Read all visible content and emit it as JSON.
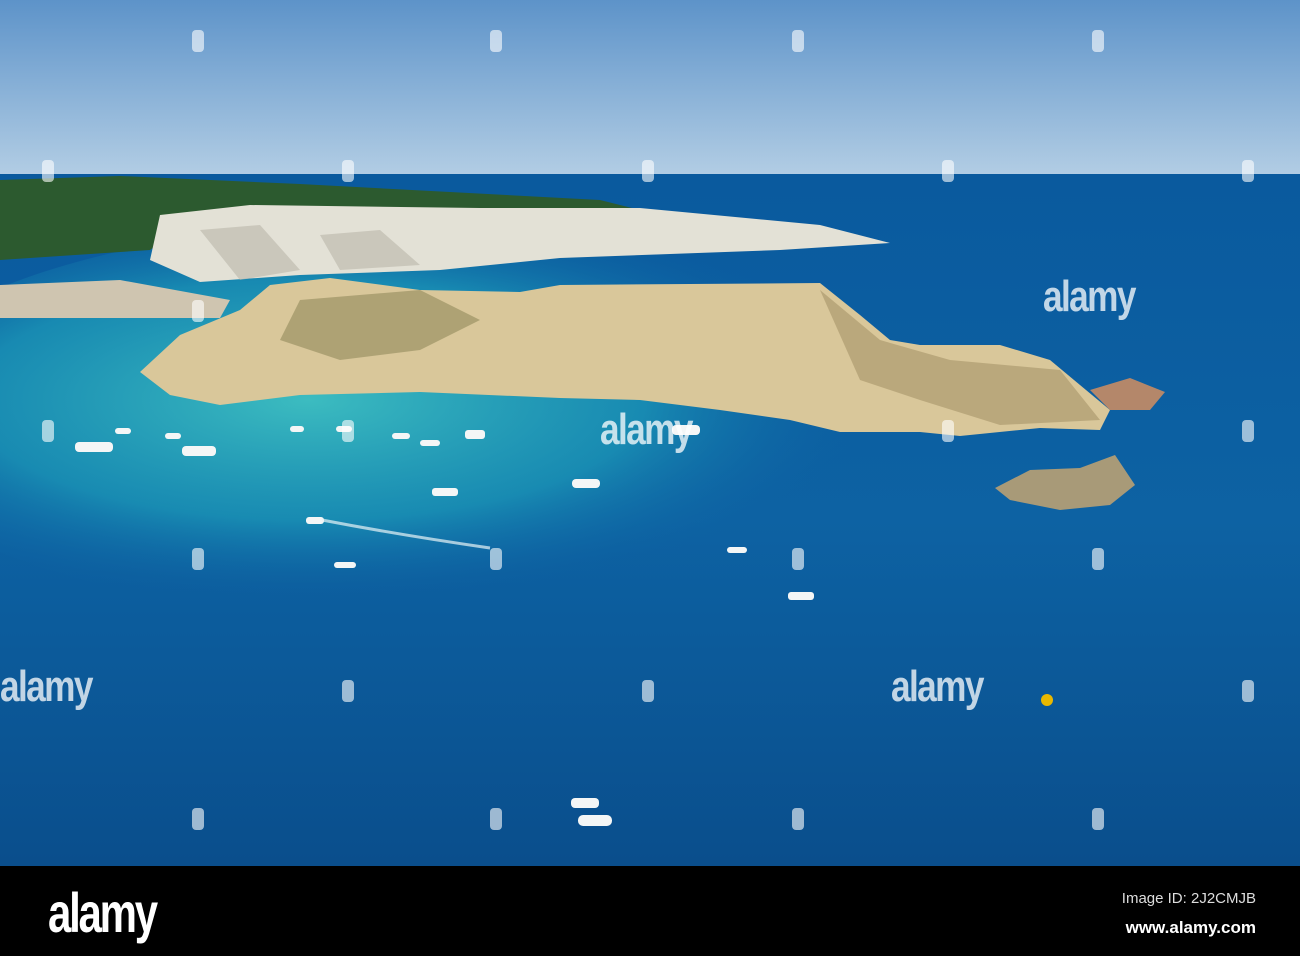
{
  "photo": {
    "subject": "Aerial view of rocky islands with boats in turquoise sea",
    "colors": {
      "sky_top": "#5d93c9",
      "sky_horizon": "#b2cde4",
      "sea_deep": "#0b4f8e",
      "sea_shallow": "#1fa7b8",
      "rock": "#d9c79a",
      "cliff": "#e3e1d6",
      "forest": "#2c5a2f"
    }
  },
  "watermark": {
    "text": "alamy"
  },
  "footer": {
    "logo": "alamy",
    "image_id": "Image ID: 2J2CMJB",
    "url": "www.alamy.com"
  }
}
